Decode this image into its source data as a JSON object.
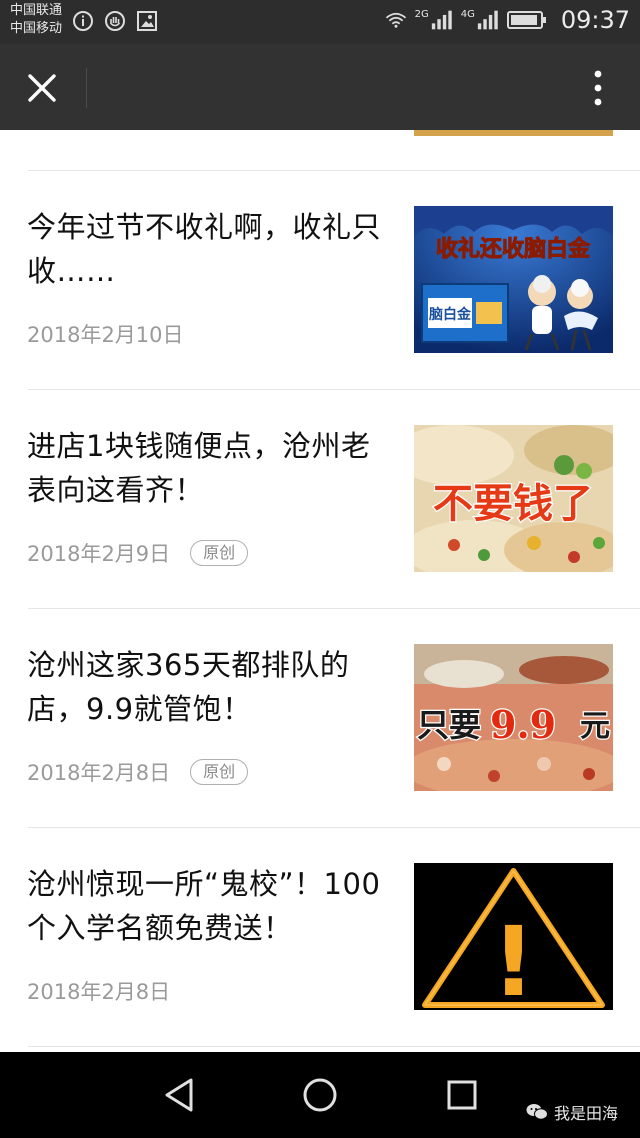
{
  "status_bar": {
    "carrier_1": "中国联通",
    "carrier_2": "中国移动",
    "net_1": "2G",
    "net_2": "4G",
    "time": "09:37"
  },
  "articles": [
    {
      "title": "今年过节不收礼啊，收礼只收……",
      "date": "2018年2月10日",
      "badge": "",
      "thumb_text": "收礼还收脑白金",
      "thumb_product": "脑白金"
    },
    {
      "title": "进店1块钱随便点，沧州老表向这看齐！",
      "date": "2018年2月9日",
      "badge": "原创",
      "thumb_text": "不要钱了"
    },
    {
      "title": "沧州这家365天都排队的店，9.9就管饱！",
      "date": "2018年2月8日",
      "badge": "原创",
      "thumb_text_1": "只要",
      "thumb_text_2": "9.9",
      "thumb_text_3": "元"
    },
    {
      "title": "沧州惊现一所“鬼校”！100个入学名额免费送！",
      "date": "2018年2月8日",
      "badge": "",
      "thumb_text": "!"
    }
  ],
  "watermark": "我是田海",
  "colors": {
    "statusbar_bg": "#2d2d2d",
    "titlebar_bg": "#323232",
    "navbar_bg": "#000000",
    "warning_orange": "#f5a623"
  }
}
